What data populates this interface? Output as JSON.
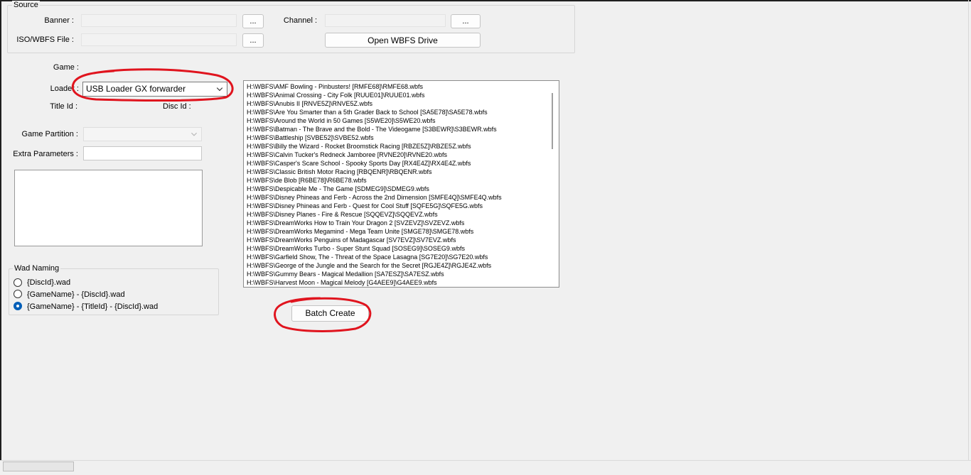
{
  "source": {
    "legend": "Source",
    "banner_label": "Banner :",
    "channel_label": "Channel :",
    "iso_label": "ISO/WBFS File :",
    "browse_label": "...",
    "open_drive_label": "Open WBFS Drive"
  },
  "game": {
    "game_label": "Game :",
    "loader_label": "Loader :",
    "loader_value": "USB Loader GX forwarder",
    "title_id_label": "Title Id :",
    "disc_id_label": "Disc Id :",
    "partition_label": "Game Partition :",
    "extra_params_label": "Extra Parameters :"
  },
  "wad_naming": {
    "legend": "Wad Naming",
    "options": [
      {
        "label": "{DiscId}.wad",
        "checked": false
      },
      {
        "label": "{GameName} - {DiscId}.wad",
        "checked": false
      },
      {
        "label": "{GameName} - {TitleId} - {DiscId}.wad",
        "checked": true
      }
    ]
  },
  "files": [
    "H:\\WBFS\\AMF Bowling - Pinbusters! [RMFE68]\\RMFE68.wbfs",
    "H:\\WBFS\\Animal Crossing - City Folk [RUUE01]\\RUUE01.wbfs",
    "H:\\WBFS\\Anubis II [RNVE5Z]\\RNVE5Z.wbfs",
    "H:\\WBFS\\Are You Smarter than a 5th Grader Back to School [SA5E78]\\SA5E78.wbfs",
    "H:\\WBFS\\Around the World in 50 Games [S5WE20]\\S5WE20.wbfs",
    "H:\\WBFS\\Batman - The Brave and the Bold - The Videogame [S3BEWR]\\S3BEWR.wbfs",
    "H:\\WBFS\\Battleship [SVBE52]\\SVBE52.wbfs",
    "H:\\WBFS\\Billy the Wizard - Rocket Broomstick Racing [RBZE5Z]\\RBZE5Z.wbfs",
    "H:\\WBFS\\Calvin Tucker's Redneck Jamboree [RVNE20]\\RVNE20.wbfs",
    "H:\\WBFS\\Casper's Scare School - Spooky Sports Day [RX4E4Z]\\RX4E4Z.wbfs",
    "H:\\WBFS\\Classic British Motor Racing [RBQENR]\\RBQENR.wbfs",
    "H:\\WBFS\\de Blob [R6BE78]\\R6BE78.wbfs",
    "H:\\WBFS\\Despicable Me - The Game [SDMEG9]\\SDMEG9.wbfs",
    "H:\\WBFS\\Disney Phineas and Ferb - Across the 2nd Dimension [SMFE4Q]\\SMFE4Q.wbfs",
    "H:\\WBFS\\Disney Phineas and Ferb - Quest for Cool Stuff [SQFE5G]\\SQFE5G.wbfs",
    "H:\\WBFS\\Disney Planes - Fire & Rescue [SQQEVZ]\\SQQEVZ.wbfs",
    "H:\\WBFS\\DreamWorks How to Train Your Dragon 2 [SVZEVZ]\\SVZEVZ.wbfs",
    "H:\\WBFS\\DreamWorks Megamind - Mega Team Unite [SMGE78]\\SMGE78.wbfs",
    "H:\\WBFS\\DreamWorks Penguins of Madagascar [SV7EVZ]\\SV7EVZ.wbfs",
    "H:\\WBFS\\DreamWorks Turbo - Super Stunt Squad [SOSEG9]\\SOSEG9.wbfs",
    "H:\\WBFS\\Garfield Show, The - Threat of the Space Lasagna [SG7E20]\\SG7E20.wbfs",
    "H:\\WBFS\\George of the Jungle and the Search for the Secret [RGJE4Z]\\RGJE4Z.wbfs",
    "H:\\WBFS\\Gummy Bears - Magical Medallion [SA7ESZ]\\SA7ESZ.wbfs",
    "H:\\WBFS\\Harvest Moon - Magical Melody [G4AEE9]\\G4AEE9.wbfs"
  ],
  "batch_create_label": "Batch Create",
  "colors": {
    "annotation": "#e0141e",
    "radio_selected": "#005fb8"
  }
}
